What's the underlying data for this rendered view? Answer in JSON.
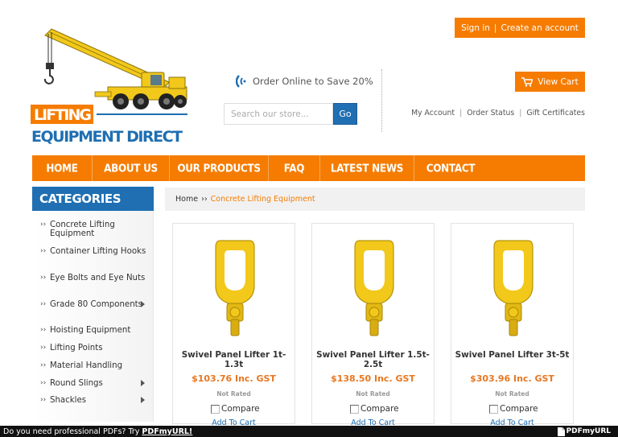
{
  "header": {
    "logo_line1": "LIFTING",
    "logo_line2": "EQUIPMENT DIRECT",
    "sign_in": "Sign in",
    "separator": "|",
    "create_account": "Create an account",
    "promo_text": "Order Online to Save 20%",
    "view_cart": "View Cart",
    "search_placeholder": "Search our store...",
    "go_label": "Go",
    "account_links": [
      "My Account",
      "Order Status",
      "Gift Certificates"
    ]
  },
  "nav": {
    "items": [
      "HOME",
      "ABOUT US",
      "OUR PRODUCTS",
      "FAQ",
      "LATEST NEWS",
      "CONTACT"
    ]
  },
  "sidebar": {
    "title": "CATEGORIES",
    "items": [
      {
        "label": "Concrete Lifting Equipment",
        "has_sub": false
      },
      {
        "label": "Container Lifting Hooks",
        "has_sub": false
      },
      {
        "label": "Eye Bolts and Eye Nuts",
        "has_sub": false
      },
      {
        "label": "Grade 80 Components",
        "has_sub": true
      },
      {
        "label": "Hoisting Equipment",
        "has_sub": false
      },
      {
        "label": "Lifting Points",
        "has_sub": false
      },
      {
        "label": "Material Handling",
        "has_sub": false
      },
      {
        "label": "Round Slings",
        "has_sub": true
      },
      {
        "label": "Shackles",
        "has_sub": true
      }
    ]
  },
  "breadcrumb": {
    "home": "Home",
    "separator": "››",
    "current": "Concrete Lifting Equipment"
  },
  "products": [
    {
      "name": "Swivel Panel Lifter 1t-1.3t",
      "price": "$103.76 Inc. GST",
      "rating": "Not Rated",
      "compare": "Compare",
      "add_to_cart": "Add To Cart"
    },
    {
      "name": "Swivel Panel Lifter 1.5t-2.5t",
      "price": "$138.50 Inc. GST",
      "rating": "Not Rated",
      "compare": "Compare",
      "add_to_cart": "Add To Cart"
    },
    {
      "name": "Swivel Panel Lifter 3t-5t",
      "price": "$303.96 Inc. GST",
      "rating": "Not Rated",
      "compare": "Compare",
      "add_to_cart": "Add To Cart"
    }
  ],
  "banner": {
    "text": "Do you need professional PDFs? Try",
    "brand": "PDFmyURL!",
    "logo_text": "PDFmyURL"
  },
  "colors": {
    "accent_orange": "#f57c00",
    "brand_blue": "#1f6fb2",
    "price_orange": "#e87722",
    "product_yellow": "#f2c81a"
  },
  "icons": {
    "promo": "phone-signal-icon",
    "cart": "cart-icon",
    "list": "chevron-right-icon",
    "submenu": "caret-right-icon"
  }
}
